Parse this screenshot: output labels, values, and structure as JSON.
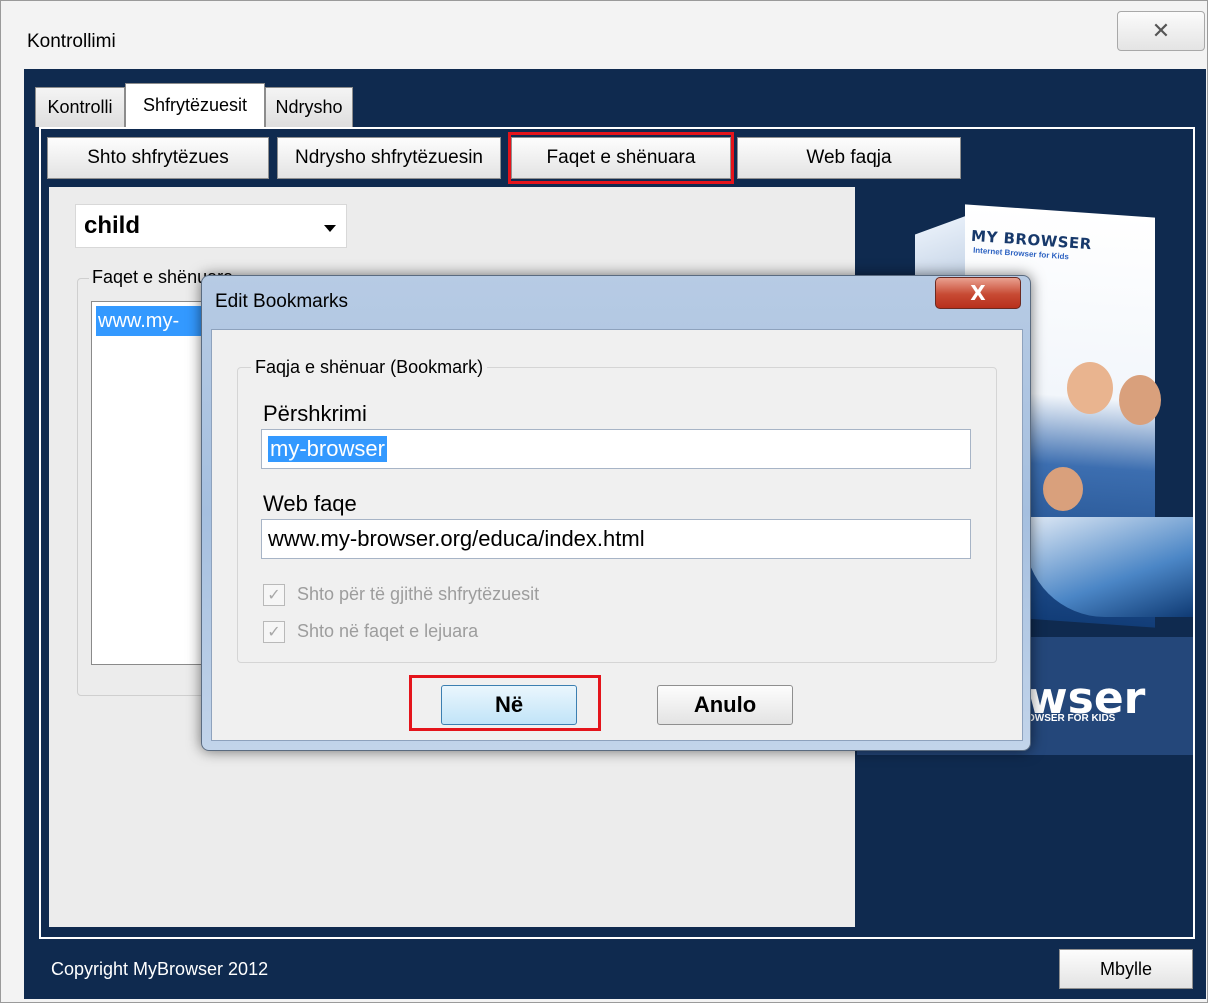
{
  "window": {
    "title": "Kontrollimi",
    "close_glyph": "✕"
  },
  "tabs": [
    {
      "label": "Kontrolli"
    },
    {
      "label": "Shfrytëzuesit"
    },
    {
      "label": "Ndrysho"
    }
  ],
  "subtabs": [
    {
      "label": "Shto shfrytëzues"
    },
    {
      "label": "Ndrysho shfrytëzuesin"
    },
    {
      "label": "Faqet e shënuara"
    },
    {
      "label": "Web faqja"
    }
  ],
  "user_panel": {
    "selected_user": "child",
    "bookmarks_group_label": "Faqet e shënuara",
    "bookmark_items": [
      "www.my-"
    ]
  },
  "promo": {
    "box_brand": "MY BROWSER",
    "box_subtitle": "Internet Browser for Kids",
    "banner_big": "wser",
    "banner_small": "OWSER FOR KIDS"
  },
  "footer": {
    "copyright": "Copyright MyBrowser 2012",
    "close_label": "Mbylle"
  },
  "dialog": {
    "title": "Edit Bookmarks",
    "close_glyph": "X",
    "group_label": "Faqja e shënuar (Bookmark)",
    "description_label": "Përshkrimi",
    "description_value": "my-browser",
    "url_label": "Web faqe",
    "url_value": "www.my-browser.org/educa/index.html",
    "checkbox_all_users": "Shto për të gjithë shfrytëzuesit",
    "checkbox_allowed": "Shto në faqet e lejuara",
    "checkbox_all_users_checked": true,
    "checkbox_allowed_checked": true,
    "check_glyph": "✓",
    "ok_label": "Në",
    "cancel_label": "Anulo"
  },
  "colors": {
    "highlight": "#e4141b",
    "navy": "#0f2a4f",
    "selection": "#3399ff"
  }
}
